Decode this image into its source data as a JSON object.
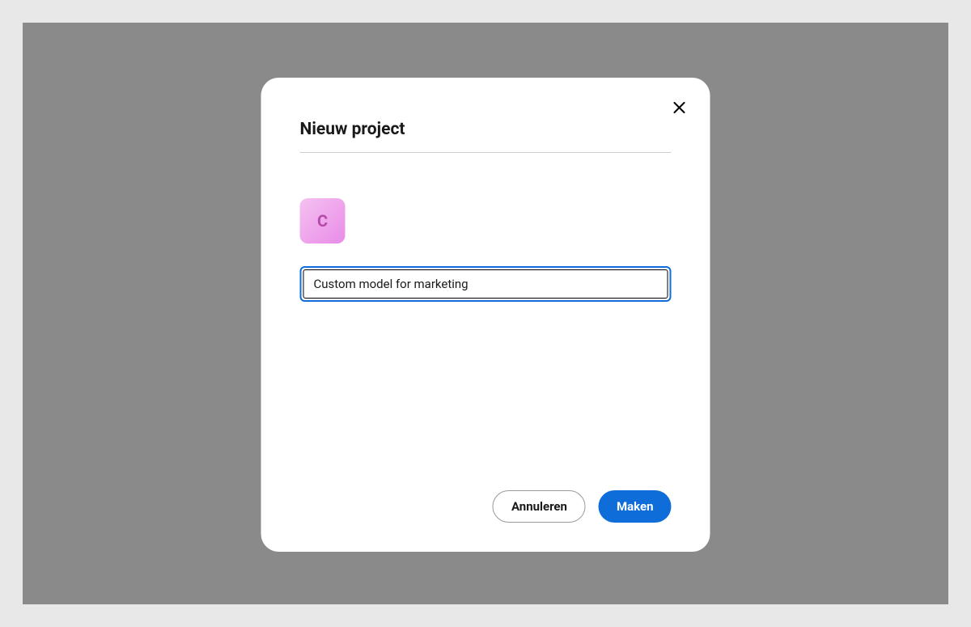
{
  "modal": {
    "title": "Nieuw project",
    "icon_letter": "C",
    "project_name_value": "Custom model for marketing",
    "cancel_label": "Annuleren",
    "create_label": "Maken"
  }
}
